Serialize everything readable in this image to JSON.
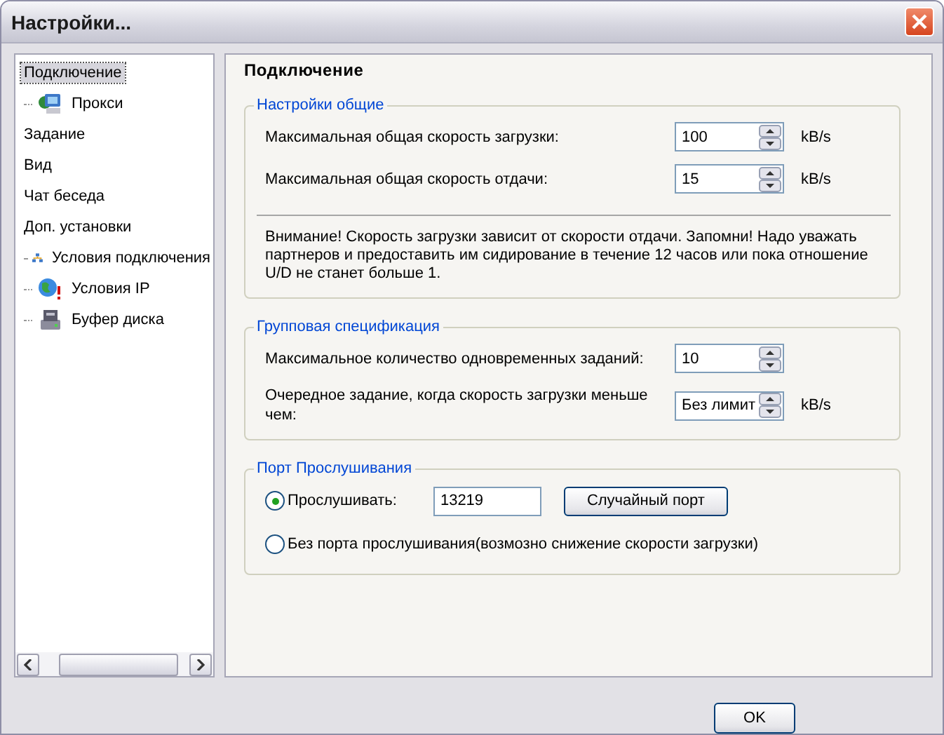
{
  "window": {
    "title": "Настройки..."
  },
  "sidebar": {
    "items": [
      {
        "label": "Подключение",
        "kind": "plain",
        "selected": true
      },
      {
        "label": "Прокси",
        "kind": "icon",
        "selected": false
      },
      {
        "label": "Задание",
        "kind": "plain",
        "selected": false
      },
      {
        "label": "Вид",
        "kind": "plain",
        "selected": false
      },
      {
        "label": "Чат беседа",
        "kind": "plain",
        "selected": false
      },
      {
        "label": "Доп. установки",
        "kind": "plain",
        "selected": false
      },
      {
        "label": "Условия подключения",
        "kind": "icon",
        "selected": false
      },
      {
        "label": "Условия IP",
        "kind": "icon",
        "selected": false
      },
      {
        "label": "Буфер диска",
        "kind": "icon",
        "selected": false
      }
    ]
  },
  "panel": {
    "title": "Подключение",
    "general": {
      "legend": "Настройки общие",
      "rows": [
        {
          "label": "Максимальная общая скорость загрузки:",
          "value": "100",
          "unit": "kB/s"
        },
        {
          "label": "Максимальная общая скорость отдачи:",
          "value": "15",
          "unit": "kB/s"
        }
      ],
      "note": "Внимание! Скорость загрузки зависит от скорости отдачи. Запомни! Надо уважать партнеров и предоставить им сидирование в течение 12 часов или пока отношение U/D не станет больше 1."
    },
    "group": {
      "legend": "Групповая спецификация",
      "rows": [
        {
          "label": "Максимальное количество одновременных заданий:",
          "value": "10"
        },
        {
          "label": "Очередное задание, когда скорость загрузки меньше чем:",
          "value": "Без лимит",
          "unit": "kB/s"
        }
      ]
    },
    "port": {
      "legend": "Порт Прослушивания",
      "options": [
        {
          "label": "Прослушивать:",
          "selected": true
        },
        {
          "label": "Без порта прослушивания(возмозно снижение скорости загрузки)",
          "selected": false
        }
      ],
      "port_value": "13219",
      "random_button": "Случайный порт"
    }
  },
  "buttons": [
    "OK"
  ]
}
